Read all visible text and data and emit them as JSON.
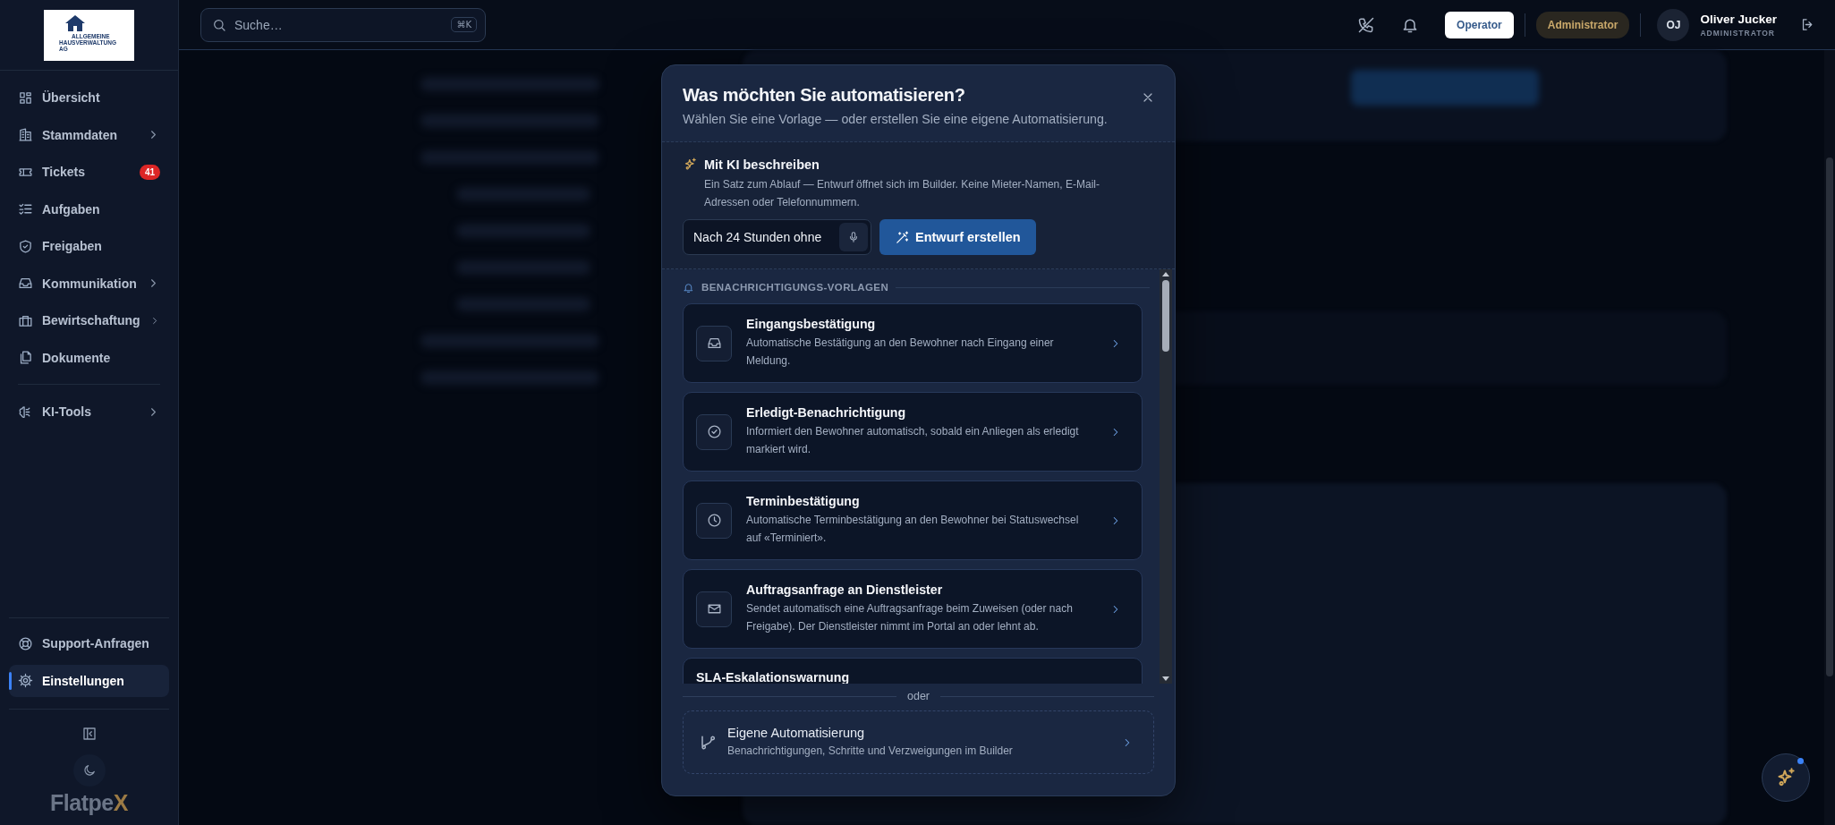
{
  "logo": {
    "lines": [
      "ALLGEMEINE",
      "HAUSVERWALTUNG",
      "AG"
    ]
  },
  "sidebar": {
    "groups": [
      [
        {
          "label": "Übersicht",
          "expandable": false,
          "selected": false
        },
        {
          "label": "Stammdaten",
          "expandable": true,
          "selected": false
        },
        {
          "label": "Tickets",
          "expandable": false,
          "selected": false,
          "badge": "41"
        },
        {
          "label": "Aufgaben",
          "expandable": false,
          "selected": false
        },
        {
          "label": "Freigaben",
          "expandable": false,
          "selected": false
        },
        {
          "label": "Kommunikation",
          "expandable": true,
          "selected": false
        },
        {
          "label": "Bewirtschaftung",
          "expandable": true,
          "selected": false
        },
        {
          "label": "Dokumente",
          "expandable": false,
          "selected": false
        }
      ],
      [
        {
          "label": "KI-Tools",
          "expandable": true,
          "selected": false
        }
      ]
    ],
    "footer_items": [
      {
        "label": "Support-Anfragen",
        "expandable": false,
        "selected": false
      },
      {
        "label": "Einstellungen",
        "expandable": false,
        "selected": true
      }
    ],
    "brand": {
      "name": "Flatpe",
      "accent": "X"
    }
  },
  "topbar": {
    "search": {
      "placeholder": "Suche…",
      "shortcut": "⌘K"
    },
    "roles": [
      {
        "label": "Operator",
        "selected": true
      },
      {
        "label": "Administrator",
        "selected": false
      }
    ],
    "user": {
      "initials": "OJ",
      "name": "Oliver Jucker",
      "role": "ADMINISTRATOR"
    }
  },
  "modal": {
    "title": "Was möchten Sie automatisieren?",
    "subtitle": "Wählen Sie eine Vorlage — oder erstellen Sie eine eigene Automatisierung.",
    "ai": {
      "title": "Mit KI beschreiben",
      "description": "Ein Satz zum Ablauf — Entwurf öffnet sich im Builder. Keine Mieter-Namen, E-Mail-Adressen oder Telefonnummern.",
      "input": "Nach 24 Stunden ohne",
      "button": "Entwurf erstellen"
    },
    "section": "BENACHRICHTIGUNGS-VORLAGEN",
    "templates": [
      {
        "title": "Eingangsbestätigung",
        "description": "Automatische Bestätigung an den Bewohner nach Eingang einer Meldung."
      },
      {
        "title": "Erledigt-Benachrichtigung",
        "description": "Informiert den Bewohner automatisch, sobald ein Anliegen als erledigt markiert wird."
      },
      {
        "title": "Terminbestätigung",
        "description": "Automatische Terminbestätigung an den Bewohner bei Statuswechsel auf «Terminiert»."
      },
      {
        "title": "Auftragsanfrage an Dienstleister",
        "description": "Sendet automatisch eine Auftragsanfrage beim Zuweisen (oder nach Freigabe). Der Dienstleister nimmt im Portal an oder lehnt ab."
      },
      {
        "title": "SLA-Eskalationswarnung"
      }
    ],
    "separator": "oder",
    "custom": {
      "title": "Eigene Automatisierung",
      "description": "Benachrichtigungen, Schritte und Verzweigungen im Builder"
    }
  }
}
